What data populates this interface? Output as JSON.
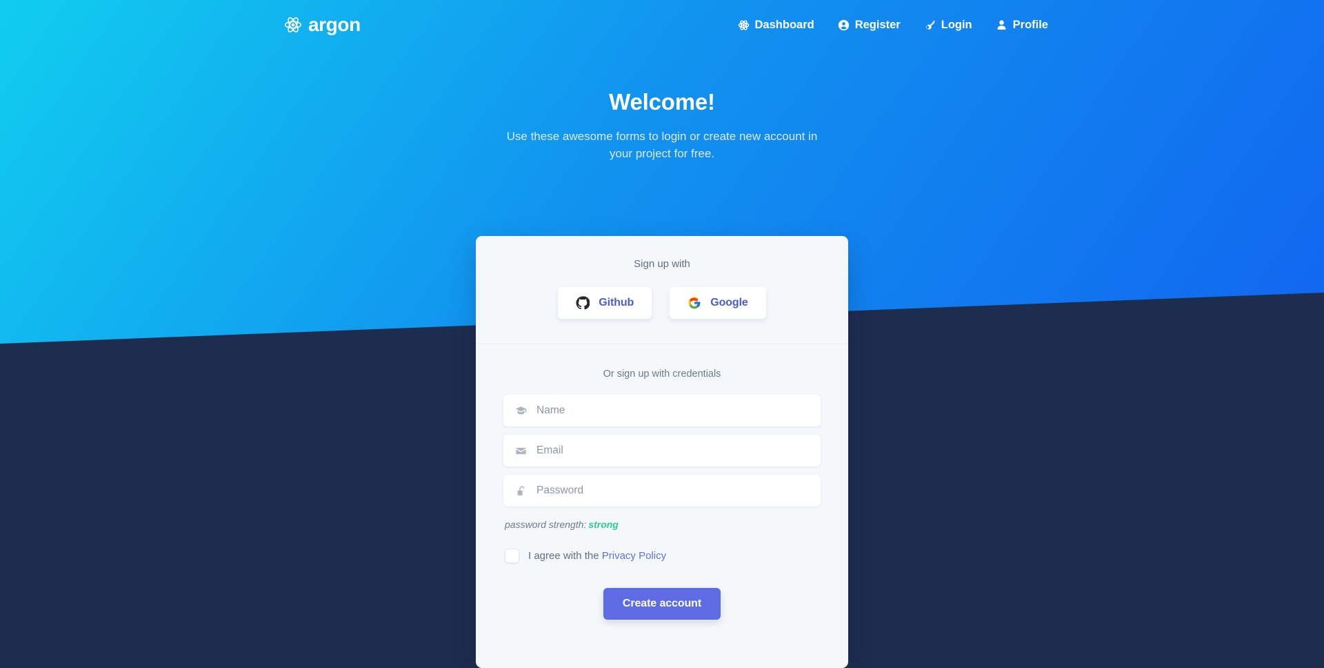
{
  "navbar": {
    "brand": {
      "name": "argon",
      "icon": "atom-icon"
    },
    "links": [
      {
        "label": "Dashboard",
        "icon": "atom-icon"
      },
      {
        "label": "Register",
        "icon": "user-circle-icon"
      },
      {
        "label": "Login",
        "icon": "key-icon"
      },
      {
        "label": "Profile",
        "icon": "user-icon"
      }
    ]
  },
  "hero": {
    "title": "Welcome!",
    "subtitle": "Use these awesome forms to login or create new account in your project for free."
  },
  "card": {
    "header_label": "Sign up with",
    "social_buttons": [
      {
        "label": "Github",
        "icon": "github-icon"
      },
      {
        "label": "Google",
        "icon": "google-icon"
      }
    ],
    "credentials_label": "Or sign up with credentials",
    "fields": [
      {
        "name": "name",
        "placeholder": "Name",
        "value": "",
        "icon": "graduation-cap-icon"
      },
      {
        "name": "email",
        "placeholder": "Email",
        "value": "",
        "icon": "envelope-icon"
      },
      {
        "name": "password",
        "placeholder": "Password",
        "value": "",
        "icon": "unlock-icon"
      }
    ],
    "password_strength": {
      "label": "password strength:",
      "value": "strong",
      "color": "#2dce89"
    },
    "agreement": {
      "prefix": "I agree with the",
      "link_label": "Privacy Policy",
      "checked": false
    },
    "submit_label": "Create account"
  },
  "colors": {
    "gradient_start": "#11cdef",
    "gradient_end": "#1165ef",
    "dark_section": "#1c2d4f",
    "primary": "#5e72e4",
    "card_bg": "#f5f8fb",
    "success": "#2dce89"
  }
}
